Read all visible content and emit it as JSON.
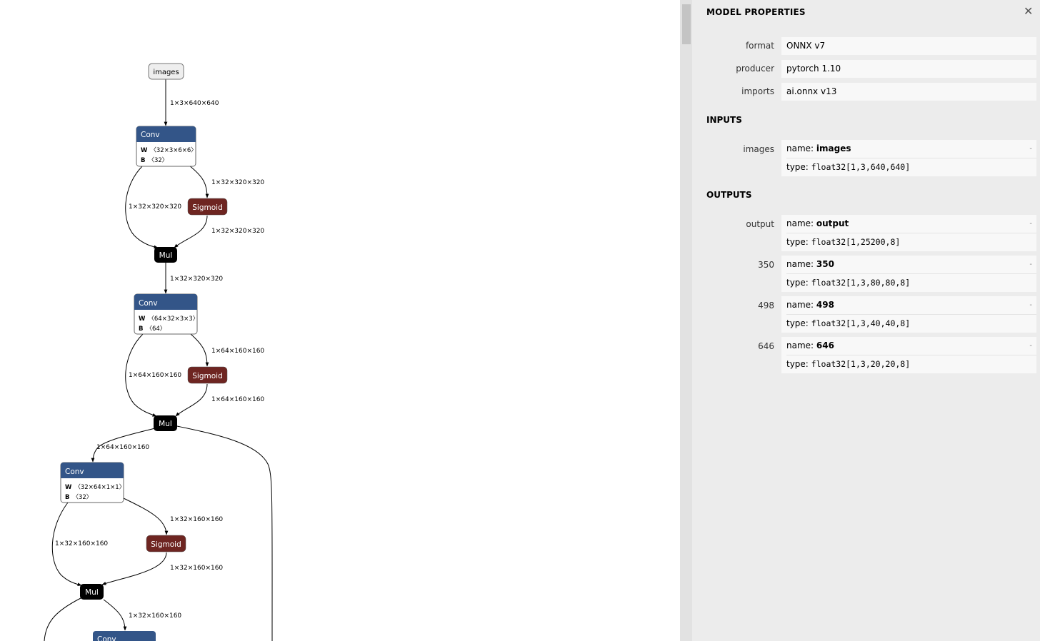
{
  "graph": {
    "input_node": "images",
    "nodes": {
      "conv1": {
        "op": "Conv",
        "w": "〈32×3×6×6〉",
        "b": "〈32〉"
      },
      "sig1": {
        "op": "Sigmoid"
      },
      "mul1": {
        "op": "Mul"
      },
      "conv2": {
        "op": "Conv",
        "w": "〈64×32×3×3〉",
        "b": "〈64〉"
      },
      "sig2": {
        "op": "Sigmoid"
      },
      "mul2": {
        "op": "Mul"
      },
      "conv3": {
        "op": "Conv",
        "w": "〈32×64×1×1〉",
        "b": "〈32〉"
      },
      "sig3": {
        "op": "Sigmoid"
      },
      "mul3": {
        "op": "Mul"
      },
      "conv4": {
        "op": "Conv"
      }
    },
    "attr_keys": {
      "w": "W",
      "b": "B"
    },
    "edge_labels": {
      "e_in": "1×3×640×640",
      "e1_sig": "1×32×320×320",
      "e1_left": "1×32×320×320",
      "e1_sigout": "1×32×320×320",
      "e1_down": "1×32×320×320",
      "e2_sig": "1×64×160×160",
      "e2_left": "1×64×160×160",
      "e2_sigout": "1×64×160×160",
      "e2_down": "1×64×160×160",
      "e3_sig": "1×32×160×160",
      "e3_left": "1×32×160×160",
      "e3_sigout": "1×32×160×160",
      "e3_down": "1×32×160×160"
    },
    "colors": {
      "conv": "#335588",
      "sigmoid": "#6e2521",
      "mul": "#000000",
      "input": "#eeeeee"
    }
  },
  "sidebar": {
    "title": "MODEL PROPERTIES",
    "close_icon": "✕",
    "properties": [
      {
        "name": "format",
        "value": "ONNX v7"
      },
      {
        "name": "producer",
        "value": "pytorch 1.10"
      },
      {
        "name": "imports",
        "value": "ai.onnx v13"
      }
    ],
    "inputs_heading": "INPUTS",
    "inputs": [
      {
        "label": "images",
        "name_prefix": "name: ",
        "name": "images",
        "type_prefix": "type: ",
        "type": "float32[1,3,640,640]",
        "expand": "-"
      }
    ],
    "outputs_heading": "OUTPUTS",
    "outputs": [
      {
        "label": "output",
        "name_prefix": "name: ",
        "name": "output",
        "type_prefix": "type: ",
        "type": "float32[1,25200,8]",
        "expand": "-"
      },
      {
        "label": "350",
        "name_prefix": "name: ",
        "name": "350",
        "type_prefix": "type: ",
        "type": "float32[1,3,80,80,8]",
        "expand": "-"
      },
      {
        "label": "498",
        "name_prefix": "name: ",
        "name": "498",
        "type_prefix": "type: ",
        "type": "float32[1,3,40,40,8]",
        "expand": "-"
      },
      {
        "label": "646",
        "name_prefix": "name: ",
        "name": "646",
        "type_prefix": "type: ",
        "type": "float32[1,3,20,20,8]",
        "expand": "-"
      }
    ]
  }
}
